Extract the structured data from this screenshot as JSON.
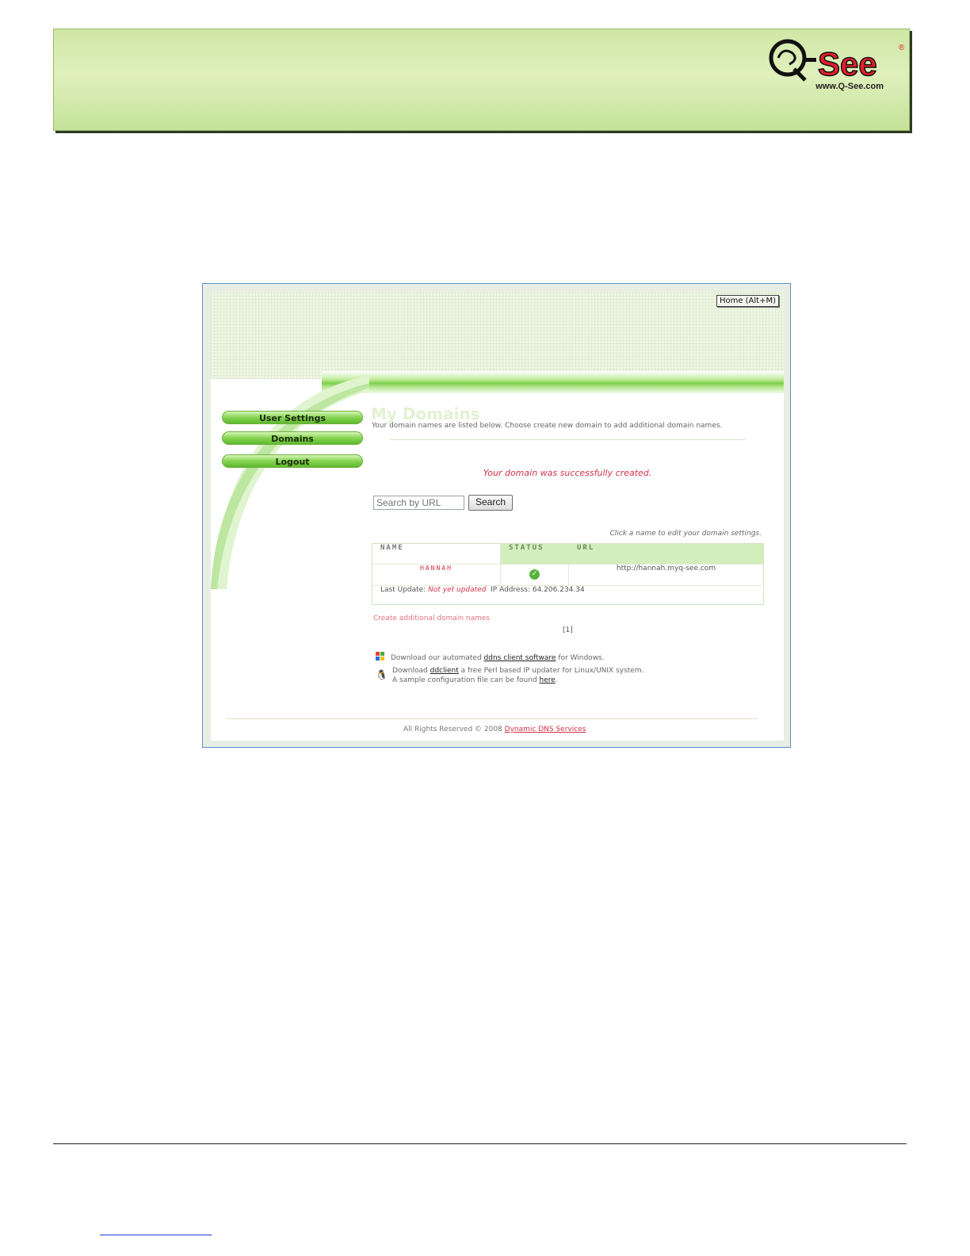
{
  "banner": {
    "logo_text": "Q-See",
    "logo_url": "www.Q-See.com"
  },
  "screenshot": {
    "home_button": "Home (Alt+M)",
    "nav": {
      "user_settings": "User Settings",
      "domains": "Domains",
      "logout": "Logout"
    },
    "page_title": "My Domains",
    "intro": "Your domain names are listed below. Choose create new domain to add additional domain names.",
    "success_message": "Your domain was successfully created.",
    "search": {
      "placeholder": "Search by URL",
      "button": "Search"
    },
    "hint": "Click a name to edit your domain settings.",
    "table": {
      "headers": [
        "NAME",
        "STATUS",
        "URL"
      ],
      "row": {
        "name": "HANNAH",
        "url": "http://hannah.myq-see.com"
      },
      "last_update_label": "Last Update:",
      "last_update_value": "Not yet updated",
      "ip_label": "IP Address:",
      "ip_value": "64.206.234.34"
    },
    "create_link": "Create additional domain names",
    "pager": "[1]",
    "download1": {
      "prefix": "Download our automated ",
      "link": "ddns client software",
      "suffix": " for Windows."
    },
    "download2": {
      "prefix": "Download ",
      "link": "ddclient",
      "suffix": " a free Perl based IP updater for Linux/UNIX system.",
      "line2_prefix": "A sample configuration file can be found ",
      "line2_link": "here",
      "line2_suffix": "."
    },
    "copyright_prefix": "All Rights Reserved © 2008 ",
    "copyright_link": "Dynamic DNS Services"
  }
}
